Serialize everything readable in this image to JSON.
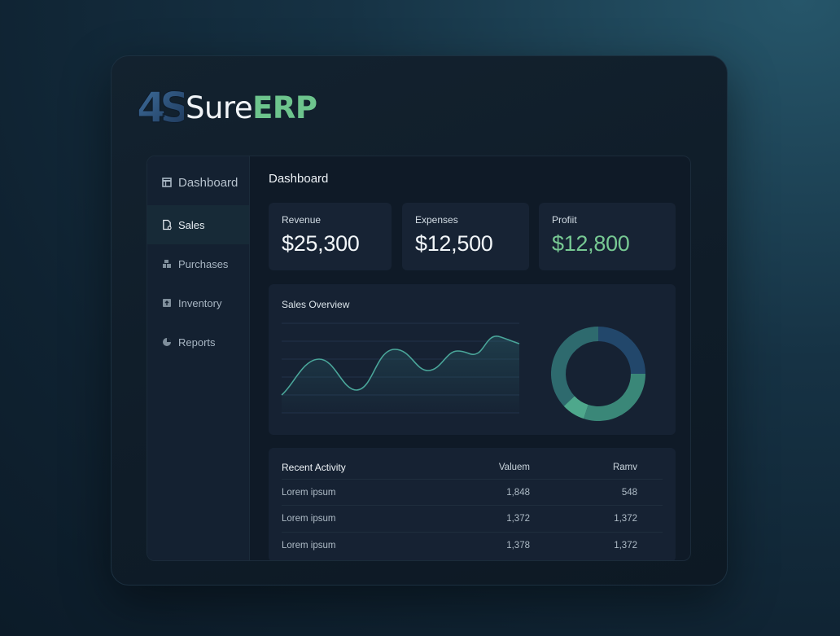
{
  "brand": {
    "mark": "4S",
    "name_part1": "Sure",
    "name_part2": "ERP"
  },
  "colors": {
    "accent": "#6dc48d",
    "teal": "#3f8c86",
    "navy": "#22476b"
  },
  "sidebar": {
    "items": [
      {
        "label": "Dashboard",
        "icon": "dashboard-icon",
        "active": false
      },
      {
        "label": "Sales",
        "icon": "sales-icon",
        "active": true
      },
      {
        "label": "Purchases",
        "icon": "purchases-icon",
        "active": false
      },
      {
        "label": "Inventory",
        "icon": "inventory-icon",
        "active": false
      },
      {
        "label": "Reports",
        "icon": "reports-icon",
        "active": false
      }
    ]
  },
  "main": {
    "title": "Dashboard",
    "kpis": [
      {
        "label": "Revenue",
        "value": "$25,300"
      },
      {
        "label": "Expenses",
        "value": "$12,500"
      },
      {
        "label": "Profiit",
        "value": "$12,800"
      }
    ],
    "sales_overview": {
      "title": "Sales Overview",
      "donut": [
        {
          "share": 0.25,
          "color": "#22476b"
        },
        {
          "share": 0.3,
          "color": "#3a8778"
        },
        {
          "share": 0.08,
          "color": "#4ea88c"
        },
        {
          "share": 0.37,
          "color": "#2e6a6e"
        }
      ]
    },
    "activity": {
      "title": "Recent Activity",
      "col2": "Valuem",
      "col3": "Ramv",
      "rows": [
        {
          "name": "Lorem ipsum",
          "v1": "1,848",
          "v2": "548"
        },
        {
          "name": "Lorem ipsum",
          "v1": "1,372",
          "v2": "1,372"
        },
        {
          "name": "Lorem ipsum",
          "v1": "1,378",
          "v2": "1,372"
        }
      ]
    }
  }
}
